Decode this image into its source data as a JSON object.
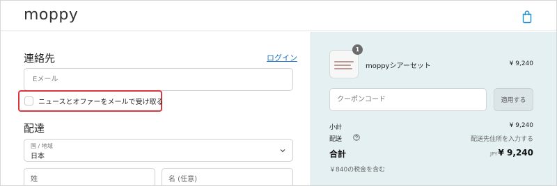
{
  "header": {
    "logo": "moppy"
  },
  "contact": {
    "title": "連絡先",
    "login_link": "ログイン",
    "email_placeholder": "Eメール",
    "optin_label": "ニュースとオファーをメールで受け取る"
  },
  "delivery": {
    "title": "配達",
    "country_caption": "国 / 地域",
    "country_value": "日本",
    "last_name_placeholder": "姓",
    "first_name_placeholder": "名 (任意)"
  },
  "summary": {
    "product": {
      "quantity": "1",
      "name": "moppyシアーセット",
      "price": "¥ 9,240"
    },
    "coupon_placeholder": "クーポンコード",
    "apply_label": "適用する",
    "subtotal_label": "小計",
    "subtotal_value": "¥ 9,240",
    "shipping_label": "配送",
    "shipping_value": "配送先住所を入力する",
    "total_label": "合計",
    "total_currency": "JPY",
    "total_value": "¥ 9,240",
    "tax_note": "￥840の税金を含む"
  },
  "colors": {
    "accent_link": "#1a73c8",
    "highlight_border": "#d9363e",
    "summary_bg": "#e5f0f2"
  }
}
